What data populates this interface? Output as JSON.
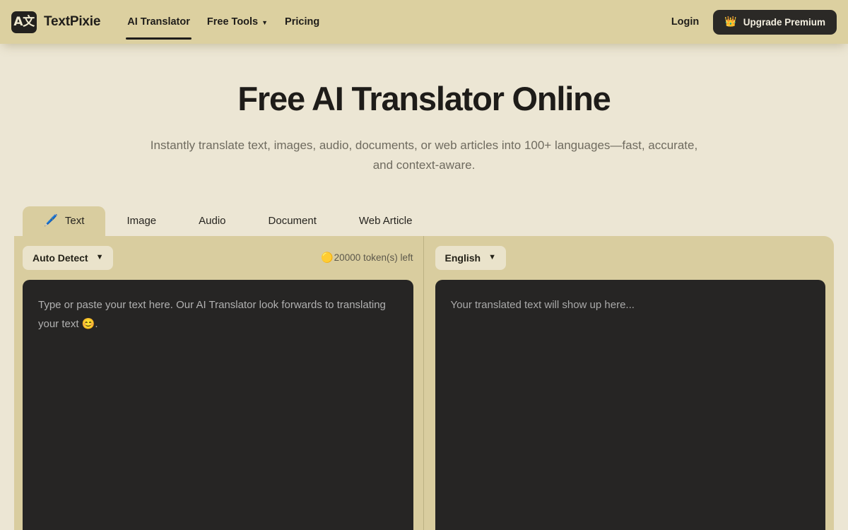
{
  "header": {
    "logo_text": "A文",
    "logo_icon": "translate-logo-icon",
    "brand_name": "TextPixie",
    "nav": [
      {
        "label": "AI Translator",
        "active": true,
        "has_caret": false
      },
      {
        "label": "Free Tools",
        "active": false,
        "has_caret": true,
        "caret": "▼"
      },
      {
        "label": "Pricing",
        "active": false,
        "has_caret": false
      }
    ],
    "login_label": "Login",
    "premium_label": "Upgrade Premium",
    "premium_icon": "👑",
    "accent_dark": "#2b2926",
    "header_bg": "#dcd0a0"
  },
  "hero": {
    "title": "Free AI Translator Online",
    "subtitle": "Instantly translate text, images, audio, documents, or web articles into 100+ languages—fast, accurate, and context-aware."
  },
  "tabs": [
    {
      "label": "Text",
      "icon": "🖊️",
      "active": true
    },
    {
      "label": "Image",
      "icon": "",
      "active": false
    },
    {
      "label": "Audio",
      "icon": "",
      "active": false
    },
    {
      "label": "Document",
      "icon": "",
      "active": false
    },
    {
      "label": "Web Article",
      "icon": "",
      "active": false
    }
  ],
  "translator": {
    "source": {
      "language": "Auto Detect",
      "caret": "▼",
      "placeholder": "Type or paste your text here. Our AI Translator look forwards to translating your text 😊.",
      "value": ""
    },
    "tokens": {
      "icon": "🟡",
      "label": "20000 token(s) left"
    },
    "target": {
      "language": "English",
      "caret": "▼",
      "placeholder": "Your translated text will show up here...",
      "value": ""
    },
    "panel_bg": "#d9cd9f",
    "editor_bg": "#262524"
  }
}
